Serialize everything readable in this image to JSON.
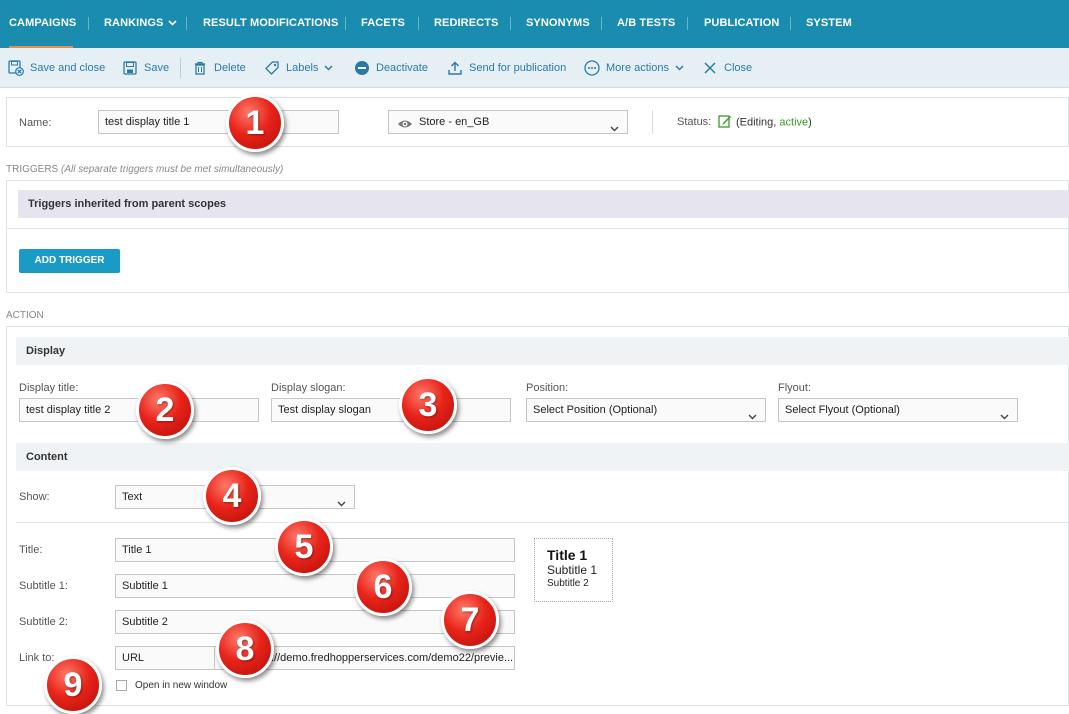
{
  "topnav": {
    "items": [
      "CAMPAIGNS",
      "RANKINGS",
      "RESULT MODIFICATIONS",
      "FACETS",
      "REDIRECTS",
      "SYNONYMS",
      "A/B TESTS",
      "PUBLICATION",
      "SYSTEM"
    ],
    "active_index": 0
  },
  "toolbar": {
    "save_close": "Save and close",
    "save": "Save",
    "delete": "Delete",
    "labels": "Labels",
    "deactivate": "Deactivate",
    "send_publication": "Send for publication",
    "more_actions": "More actions",
    "close": "Close"
  },
  "header": {
    "name_label": "Name:",
    "name_value": "test display title 1",
    "store_value": "Store - en_GB",
    "status_label": "Status:",
    "status_open": "(Editing, ",
    "status_active": "active",
    "status_close": ")"
  },
  "triggers": {
    "title": "TRIGGERS",
    "note": "(All separate triggers must be met simultaneously)",
    "inherited": "Triggers inherited from parent scopes",
    "add_button": "ADD TRIGGER"
  },
  "action": {
    "title": "ACTION",
    "display_band": "Display",
    "display_title_label": "Display title:",
    "display_title_value": "test display title 2",
    "display_slogan_label": "Display slogan:",
    "display_slogan_value": "Test display slogan",
    "position_label": "Position:",
    "position_value": "Select Position (Optional)",
    "flyout_label": "Flyout:",
    "flyout_value": "Select Flyout (Optional)"
  },
  "content": {
    "band": "Content",
    "show_label": "Show:",
    "show_value": "Text",
    "title_label": "Title:",
    "title_value": "Title 1",
    "subtitle1_label": "Subtitle 1:",
    "subtitle1_value": "Subtitle 1",
    "subtitle2_label": "Subtitle 2:",
    "subtitle2_value": "Subtitle 2",
    "link_label": "Link to:",
    "link_type": "URL",
    "link_value": "://demo.fredhopperservices.com/demo22/previe...",
    "new_window_label": "Open in new window",
    "preview_title": "Title 1",
    "preview_sub1": "Subtitle 1",
    "preview_sub2": "Subtitle 2"
  },
  "badges": [
    "1",
    "2",
    "3",
    "4",
    "5",
    "6",
    "7",
    "8",
    "9"
  ],
  "colors": {
    "nav_bg": "#1a8cb0",
    "nav_active_underline": "#f08c3c",
    "toolbar_link": "#2a7aa8",
    "primary_button": "#1a9bc6",
    "active_status": "#3a9a2a",
    "badge_red": "#e8241a"
  }
}
